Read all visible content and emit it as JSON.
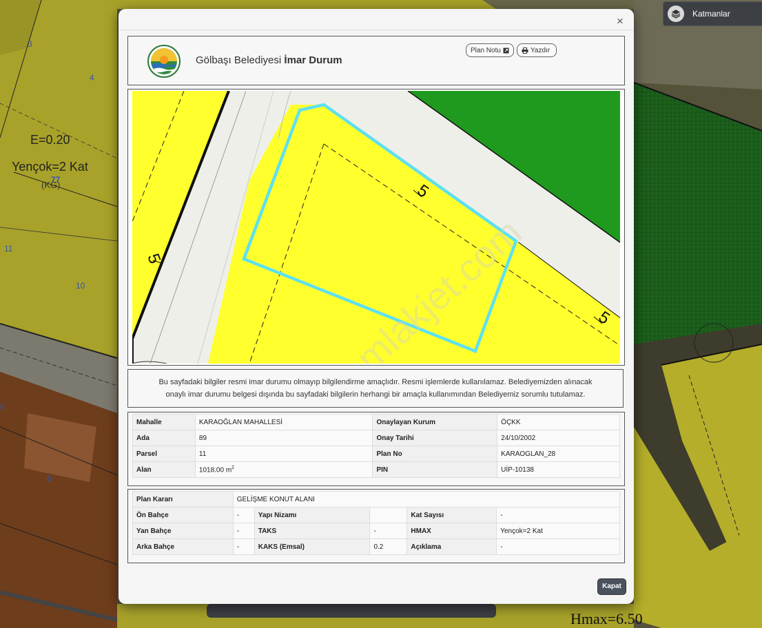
{
  "background": {
    "labels": {
      "e": "E=0.20",
      "yencok": "Yençok=2 Kat",
      "kg": "(KG)",
      "hmax": "Hmax=6.50"
    },
    "parcel_numbers": [
      "3",
      "4",
      "77",
      "11",
      "10",
      "9",
      "6"
    ]
  },
  "layers_button": {
    "label": "Katmanlar"
  },
  "modal": {
    "close_glyph": "×",
    "header": {
      "title_prefix": "Gölbaşı Belediyesi",
      "title_bold": "İmar Durum",
      "buttons": {
        "plan_notu": "Plan Notu",
        "yazdir": "Yazdır"
      }
    },
    "map": {
      "setback_labels": [
        "5",
        "5",
        "5"
      ],
      "watermark": "emlakjet.com",
      "colors": {
        "yellow_zone": "#ffff2e",
        "road": "#efefea",
        "green_zone": "#1f9a1f",
        "parcel_outline": "#5ee0f0"
      }
    },
    "disclaimer": {
      "line1": "Bu sayfadaki bilgiler resmi imar durumu olmayıp bilgilendirme amaçlıdır. Resmi işlemlerde kullanılamaz. Belediyemizden alınacak",
      "line2": "onaylı imar durumu belgesi dışında bu sayfadaki bilgilerin herhangi bir amaçla kullanımından Belediyemiz sorumlu tutulamaz."
    },
    "info_table": {
      "rows": [
        {
          "l1": "Mahalle",
          "v1": "KARAOĞLAN MAHALLESİ",
          "l2": "Onaylayan Kurum",
          "v2": "ÖÇKK"
        },
        {
          "l1": "Ada",
          "v1": "89",
          "l2": "Onay Tarihi",
          "v2": "24/10/2002"
        },
        {
          "l1": "Parsel",
          "v1": "11",
          "l2": "Plan No",
          "v2": "KARAOGLAN_28"
        },
        {
          "l1": "Alan",
          "v1": "1018.00 m",
          "v1_sup": "2",
          "l2": "PIN",
          "v2": "UİP-10138"
        }
      ]
    },
    "plan_table": {
      "plan_karari_label": "Plan Kararı",
      "plan_karari_value": "GELİŞME KONUT ALANI",
      "rows": [
        {
          "a": "Ön Bahçe",
          "av": "-",
          "b": "Yapı Nizamı",
          "bv": "",
          "c": "Kat Sayısı",
          "cv": "-"
        },
        {
          "a": "Yan Bahçe",
          "av": "-",
          "b": "TAKS",
          "bv": "-",
          "c": "HMAX",
          "cv": "Yençok=2 Kat"
        },
        {
          "a": "Arka Bahçe",
          "av": "-",
          "b": "KAKS (Emsal)",
          "bv": "0.2",
          "c": "Açıklama",
          "cv": "-"
        }
      ]
    },
    "close_button": "Kapat"
  }
}
